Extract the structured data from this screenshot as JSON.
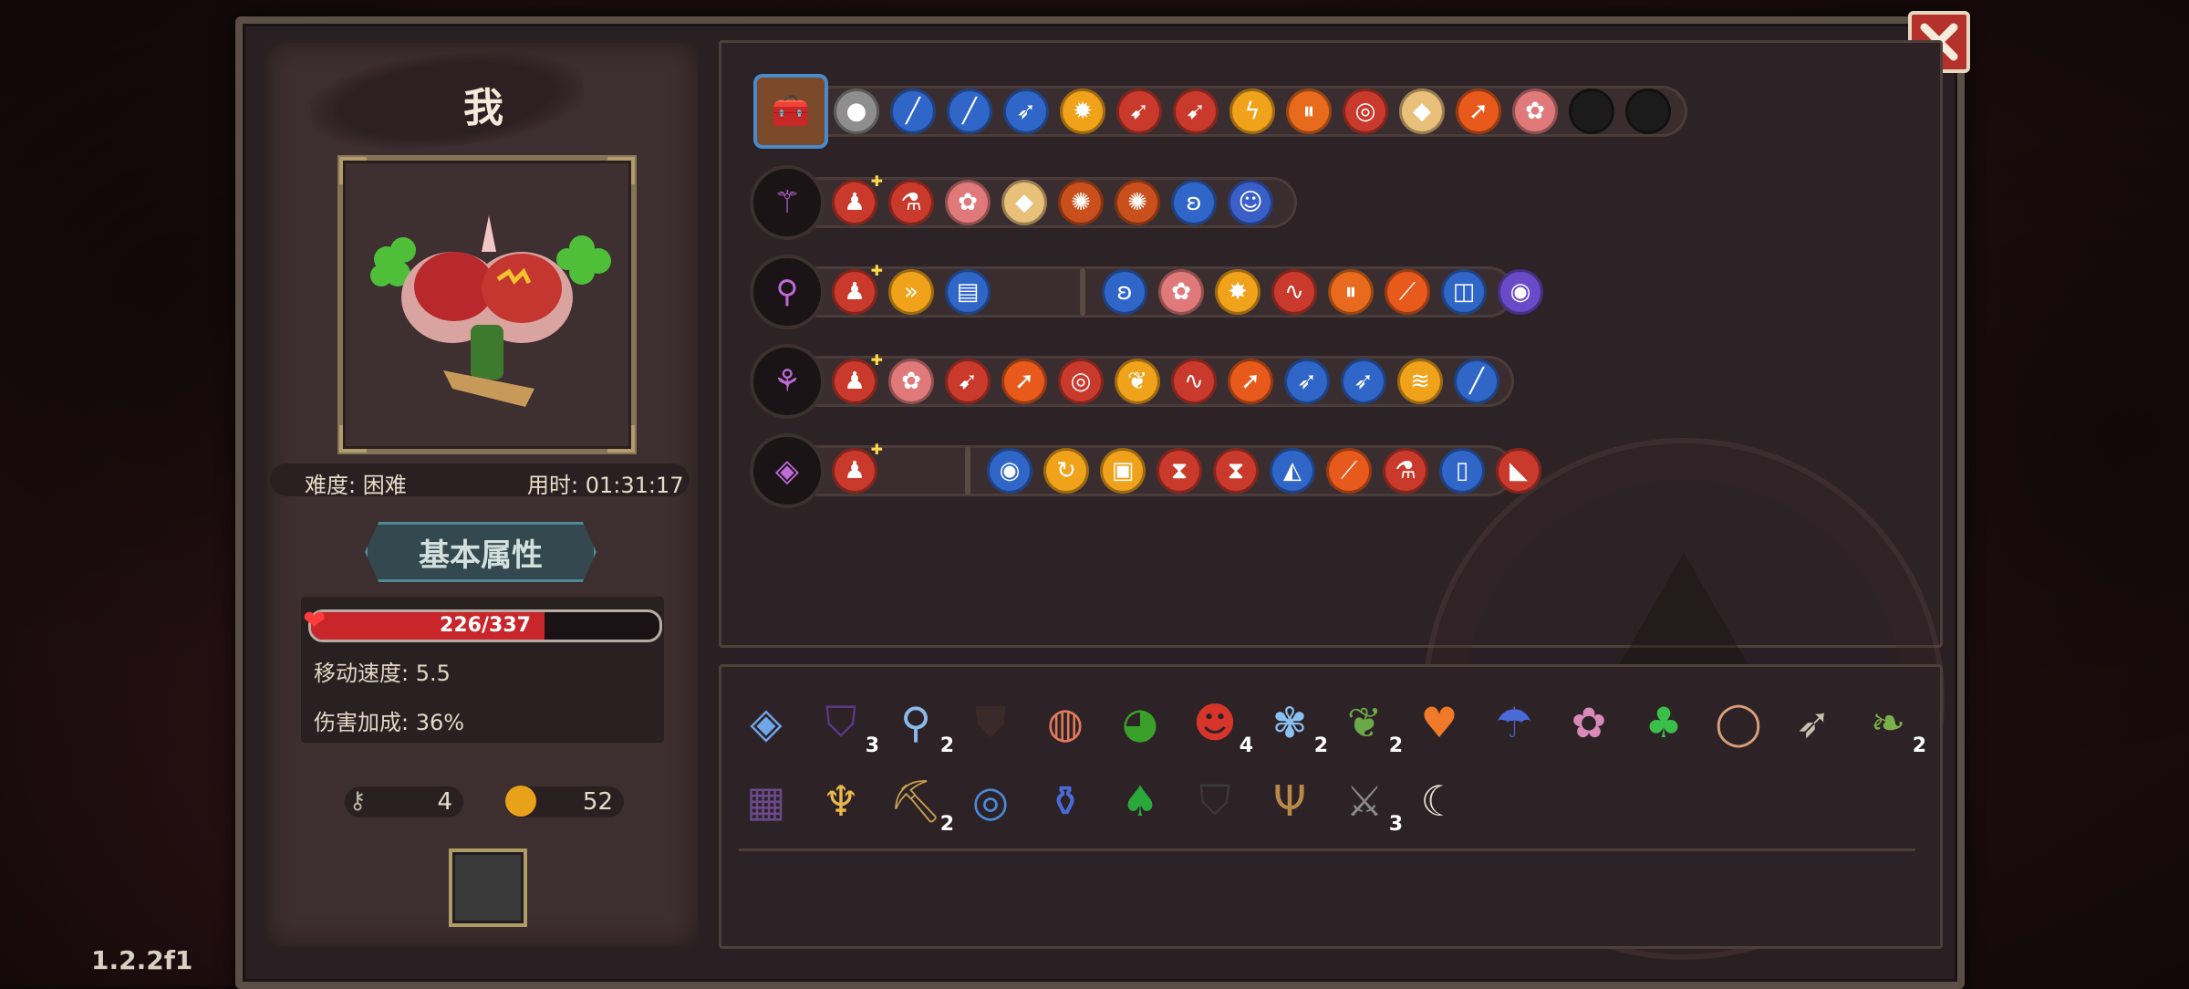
{
  "player": {
    "name": "我"
  },
  "info": {
    "difficulty": "难度: 困难",
    "time": "用时: 01:31:17"
  },
  "tabs": {
    "basic_stats": "基本属性"
  },
  "stats": {
    "hp": "226/337",
    "hp_fraction": 0.6706,
    "move_speed": "移动速度: 5.5",
    "damage_bonus": "伤害加成: 36%"
  },
  "currency": {
    "keys": "4",
    "coins": "52"
  },
  "version": "1.2.2f1",
  "colors": {
    "orange": "#f0a21a",
    "blue": "#2f66c8",
    "red": "#c93a2c",
    "pink": "#e07a7a",
    "gray": "#6a6a6a",
    "dark": "#1b1b1b"
  },
  "weapon_rows": {
    "row0": {
      "icon": "treasure-chest-icon",
      "chips": [
        "stone",
        "blade",
        "blade",
        "feather",
        "sun",
        "bow",
        "bow",
        "bolt",
        "pause",
        "target",
        "bread",
        "arrow",
        "fire-flower",
        "empty",
        "empty"
      ]
    },
    "row1": {
      "icon": "staff-icon",
      "chips": [
        "totem",
        "potion",
        "flower",
        "bread",
        "flame",
        "flame",
        "butterfly",
        "slime"
      ]
    },
    "row2": {
      "icon": "scepter-icon",
      "chips": [
        "totem",
        "dash",
        "book",
        "butterfly",
        "flower",
        "spark",
        "swirl",
        "pause",
        "claw",
        "spiral",
        "vortex"
      ]
    },
    "row3": {
      "icon": "wand-icon",
      "chips": [
        "totem",
        "flower",
        "bow",
        "arrow",
        "target",
        "wing",
        "swirl",
        "arrow",
        "feather",
        "feather",
        "waves",
        "blade"
      ]
    },
    "row4": {
      "icon": "orb-icon",
      "chips": [
        "totem",
        "eye",
        "charge",
        "card",
        "hourglass",
        "hourglass",
        "crystal",
        "claw",
        "potion",
        "vial",
        "shard"
      ]
    }
  },
  "items": {
    "row1": [
      {
        "icon": "shield-gem-icon",
        "count": ""
      },
      {
        "icon": "cape-icon",
        "count": "3"
      },
      {
        "icon": "magnifier-icon",
        "count": "2"
      },
      {
        "icon": "armor-icon",
        "count": ""
      },
      {
        "icon": "amulet-icon",
        "count": ""
      },
      {
        "icon": "frog-icon",
        "count": ""
      },
      {
        "icon": "demon-mask-icon",
        "count": "4"
      },
      {
        "icon": "lotus-icon",
        "count": "2"
      },
      {
        "icon": "herb-icon",
        "count": "2"
      },
      {
        "icon": "heart-icon",
        "count": ""
      },
      {
        "icon": "jellyfish-icon",
        "count": ""
      },
      {
        "icon": "brain-icon",
        "count": ""
      },
      {
        "icon": "clover-icon",
        "count": ""
      },
      {
        "icon": "egg-icon",
        "count": ""
      },
      {
        "icon": "spear-icon",
        "count": ""
      },
      {
        "icon": "root-icon",
        "count": "2"
      }
    ],
    "row2": [
      {
        "icon": "cage-icon",
        "count": ""
      },
      {
        "icon": "chalice-icon",
        "count": ""
      },
      {
        "icon": "pickaxe-icon",
        "count": "2"
      },
      {
        "icon": "ring-icon",
        "count": ""
      },
      {
        "icon": "bottle-icon",
        "count": ""
      },
      {
        "icon": "slime-plant-icon",
        "count": ""
      },
      {
        "icon": "robe-icon",
        "count": ""
      },
      {
        "icon": "slingshot-icon",
        "count": ""
      },
      {
        "icon": "sword-icon",
        "count": "3"
      },
      {
        "icon": "tusk-icon",
        "count": ""
      }
    ]
  }
}
